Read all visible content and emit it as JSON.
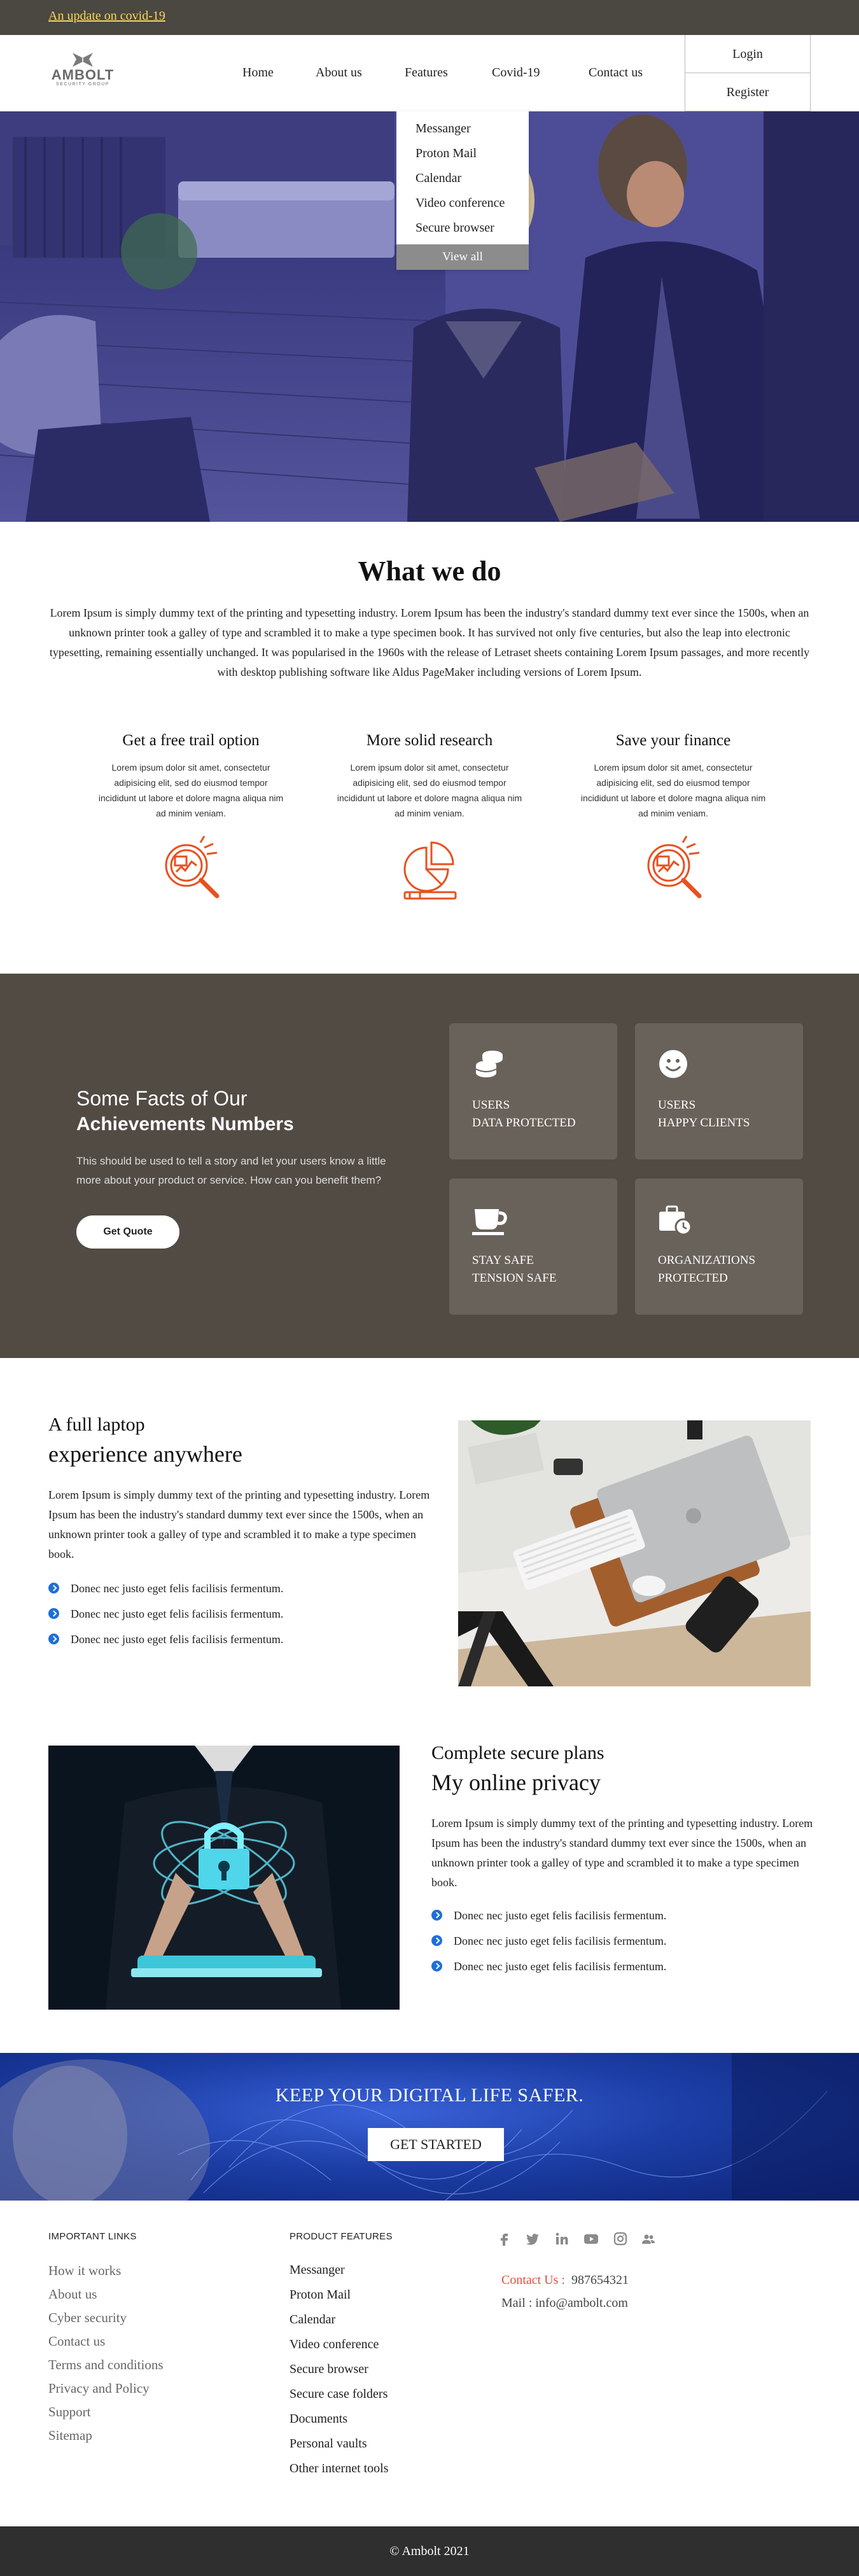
{
  "topbar": {
    "notice": "An update on covid-19"
  },
  "header": {
    "logo": {
      "name": "AMBOLT",
      "tagline": "SECURITY GROUP"
    },
    "nav": [
      "Home",
      "About us",
      "Features",
      "Covid-19",
      "Contact us"
    ],
    "login": "Login",
    "register": "Register"
  },
  "dropdown": {
    "items": [
      "Messanger",
      "Proton Mail",
      "Calendar",
      "Video conference",
      "Secure browser"
    ],
    "view_all": "View all"
  },
  "what_we_do": {
    "title": "What we do",
    "text": "Lorem Ipsum is simply dummy text of the printing and typesetting industry. Lorem Ipsum has been the industry's standard dummy text ever since the 1500s, when an unknown printer took a galley of type and scrambled it to make a type specimen book. It has survived not only five centuries, but also the leap into electronic typesetting, remaining essentially unchanged. It was popularised in the 1960s with the release of Letraset sheets containing Lorem Ipsum passages, and more recently with desktop publishing software like Aldus PageMaker including versions of Lorem Ipsum.",
    "features": [
      {
        "title": "Get a free trail option",
        "text": "Lorem ipsum dolor sit amet, consectetur adipisicing elit, sed do eiusmod tempor incididunt ut labore et dolore magna aliqua nim ad minim veniam.",
        "icon": "analytics-magnifier-icon"
      },
      {
        "title": "More solid research",
        "text": "Lorem ipsum dolor sit amet, consectetur adipisicing elit, sed do eiusmod tempor incididunt ut labore et dolore magna aliqua nim ad minim veniam.",
        "icon": "pie-chart-icon"
      },
      {
        "title": "Save your finance",
        "text": "Lorem ipsum dolor sit amet, consectetur adipisicing elit, sed do eiusmod tempor incididunt ut labore et dolore magna aliqua nim ad minim veniam.",
        "icon": "analytics-magnifier-icon"
      }
    ],
    "accent_color": "#e8501f"
  },
  "facts": {
    "heading1": "Some Facts of Our",
    "heading2": "Achievements Numbers",
    "description": "This should be used to tell a story and let your users know a little more about your product or service. How can you benefit them?",
    "button": "Get Quote",
    "cards": [
      {
        "icon": "coins-icon",
        "line1": "USERS",
        "line2": "DATA  PROTECTED"
      },
      {
        "icon": "smiley-icon",
        "line1": "USERS",
        "line2": "HAPPY CLIENTS"
      },
      {
        "icon": "coffee-cup-icon",
        "line1": "STAY SAFE",
        "line2": "TENSION SAFE"
      },
      {
        "icon": "briefcase-clock-icon",
        "line1": "ORGANIZATIONS",
        "line2": "PROTECTED"
      }
    ]
  },
  "laptop_section": {
    "subtitle": "A full laptop",
    "title": "experience anywhere",
    "text": "Lorem Ipsum is simply dummy text of the printing and typesetting industry. Lorem Ipsum has been the industry's standard dummy text ever since the 1500s, when an unknown printer took a galley of type and scrambled it to make a type specimen book.",
    "bullets": [
      "Donec nec justo eget felis facilisis fermentum.",
      "Donec nec justo eget felis facilisis fermentum.",
      "Donec nec justo eget felis facilisis fermentum."
    ]
  },
  "privacy_section": {
    "subtitle": "Complete secure plans",
    "title": "My online privacy",
    "text": "Lorem Ipsum is simply dummy text of the printing and typesetting industry. Lorem Ipsum has been the industry's standard dummy text ever since the 1500s, when an unknown printer took a galley of type and scrambled it to make a type specimen book.",
    "bullets": [
      "Donec nec justo eget felis facilisis fermentum.",
      "Donec nec justo eget felis facilisis fermentum.",
      "Donec nec justo eget felis facilisis fermentum."
    ]
  },
  "banner": {
    "title": "KEEP YOUR DIGITAL LIFE SAFER.",
    "button": "GET STARTED"
  },
  "footer": {
    "col1_heading": "IMPORTANT LINKS",
    "col1_links": [
      "How it works",
      "About us",
      "Cyber security",
      "Contact us",
      "Terms and conditions",
      "Privacy and Policy",
      "Support",
      "Sitemap"
    ],
    "col2_heading": "PRODUCT FEATURES",
    "col2_links": [
      "Messanger",
      "Proton Mail",
      "Calendar",
      "Video conference",
      "Secure browser",
      "Secure case folders",
      "Documents",
      "Personal vaults",
      "Other internet tools"
    ],
    "social": [
      "facebook-icon",
      "twitter-icon",
      "linkedin-icon",
      "youtube-icon",
      "instagram-icon",
      "users-icon"
    ],
    "contact_label": "Contact Us :",
    "contact_number": "987654321",
    "mail": "Mail : info@ambolt.com",
    "copyright": "© Ambolt 2021"
  }
}
